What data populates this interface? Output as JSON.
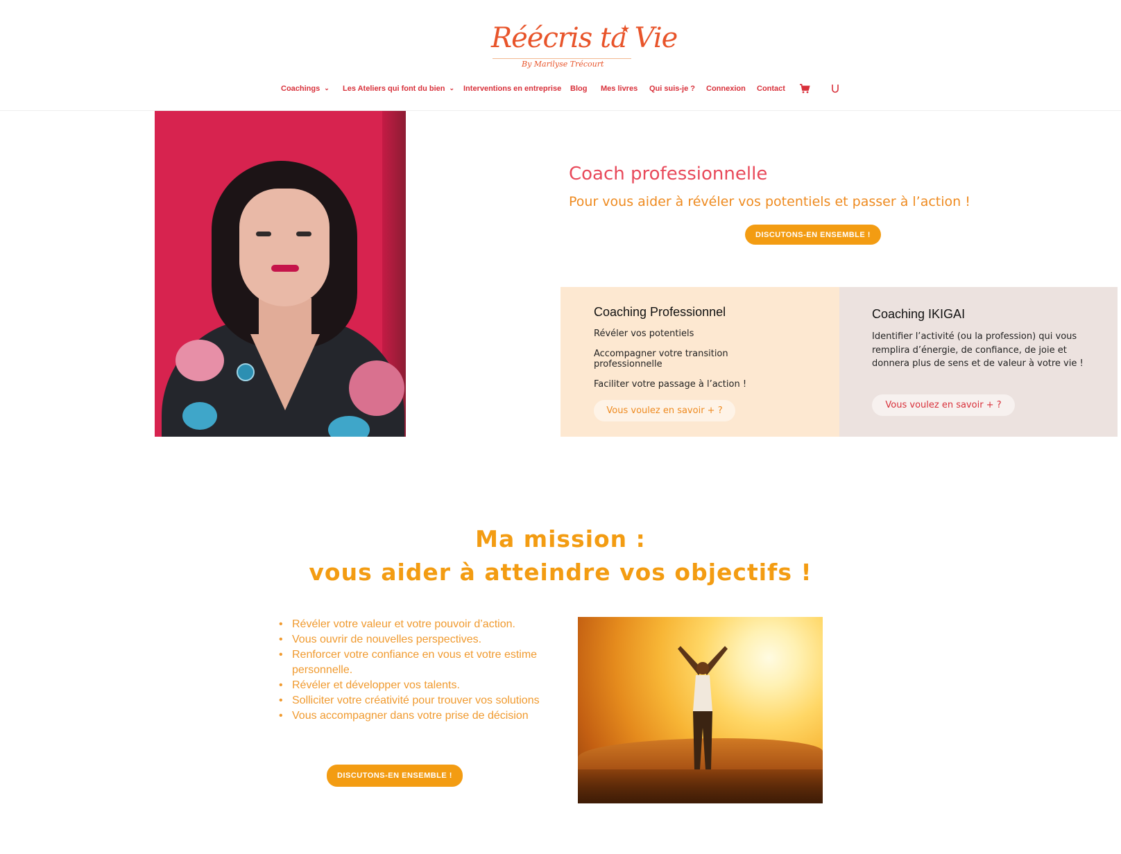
{
  "header": {
    "logo_text": "Réécris ta Vie",
    "logo_subtext": "By Marilyse Trécourt",
    "nav": [
      {
        "label": "Coachings",
        "has_dropdown": true
      },
      {
        "label": "Les Ateliers qui font du bien",
        "has_dropdown": true
      },
      {
        "label": "Interventions en entreprise",
        "has_dropdown": false
      },
      {
        "label": "Blog",
        "has_dropdown": false
      },
      {
        "label": "Mes livres",
        "has_dropdown": false
      },
      {
        "label": "Qui suis-je ?",
        "has_dropdown": false
      },
      {
        "label": "Connexion",
        "has_dropdown": false
      },
      {
        "label": "Contact",
        "has_dropdown": false
      }
    ],
    "cart_icon": "cart-icon",
    "search_icon": "search-icon"
  },
  "hero": {
    "title": "Coach professionnelle",
    "subtitle": "Pour vous aider à révéler vos potentiels et passer à l’action !",
    "cta": "DISCUTONS-EN ENSEMBLE !"
  },
  "cards": [
    {
      "title": "Coaching Professionnel",
      "lines": [
        "Révéler vos potentiels",
        "Accompagner votre transition professionnelle",
        "Faciliter votre passage à l’action !"
      ],
      "button": "Vous voulez en savoir + ?"
    },
    {
      "title": "Coaching IKIGAI",
      "text": "Identifier l’activité (ou la profession) qui vous remplira d’énergie, de confiance, de joie et donnera plus de sens et de valeur  à votre vie !",
      "button": "Vous voulez en savoir + ?"
    }
  ],
  "mission": {
    "heading_line1": "Ma mission :",
    "heading_line2": "vous aider à atteindre vos objectifs !",
    "items": [
      "Révéler votre valeur et votre pouvoir d’action.",
      "Vous ouvrir de nouvelles perspectives.",
      "Renforcer votre confiance en vous et votre estime personnelle.",
      "Révéler et développer vos talents.",
      "Solliciter votre créativité pour trouver vos solutions",
      "Vous accompagner dans votre prise de décision"
    ],
    "cta": "DISCUTONS-EN ENSEMBLE !"
  },
  "colors": {
    "brand_red": "#d8303a",
    "brand_orange": "#f39c12",
    "card1_bg": "#fde8d1",
    "card2_bg": "#ece2df"
  }
}
